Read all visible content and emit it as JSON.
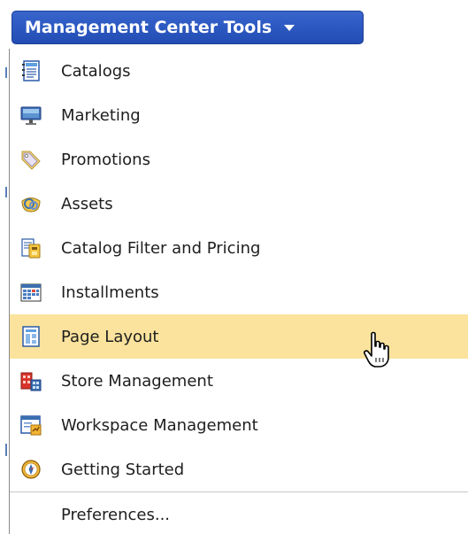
{
  "header": {
    "title": "Management Center Tools"
  },
  "menu": {
    "items": [
      {
        "label": "Catalogs",
        "icon": "catalogs-icon"
      },
      {
        "label": "Marketing",
        "icon": "marketing-icon"
      },
      {
        "label": "Promotions",
        "icon": "promotions-icon"
      },
      {
        "label": "Assets",
        "icon": "assets-icon"
      },
      {
        "label": "Catalog Filter and Pricing",
        "icon": "catalog-filter-pricing-icon"
      },
      {
        "label": "Installments",
        "icon": "installments-icon"
      },
      {
        "label": "Page Layout",
        "icon": "page-layout-icon",
        "hovered": true
      },
      {
        "label": "Store Management",
        "icon": "store-management-icon"
      },
      {
        "label": "Workspace Management",
        "icon": "workspace-management-icon"
      },
      {
        "label": "Getting Started",
        "icon": "getting-started-icon"
      }
    ],
    "preferences_label": "Preferences..."
  },
  "colors": {
    "header_blue": "#2c59c2",
    "hover_highlight": "#fbe39d",
    "text": "#1e1e1e"
  },
  "cursor": "hand-pointer-icon"
}
